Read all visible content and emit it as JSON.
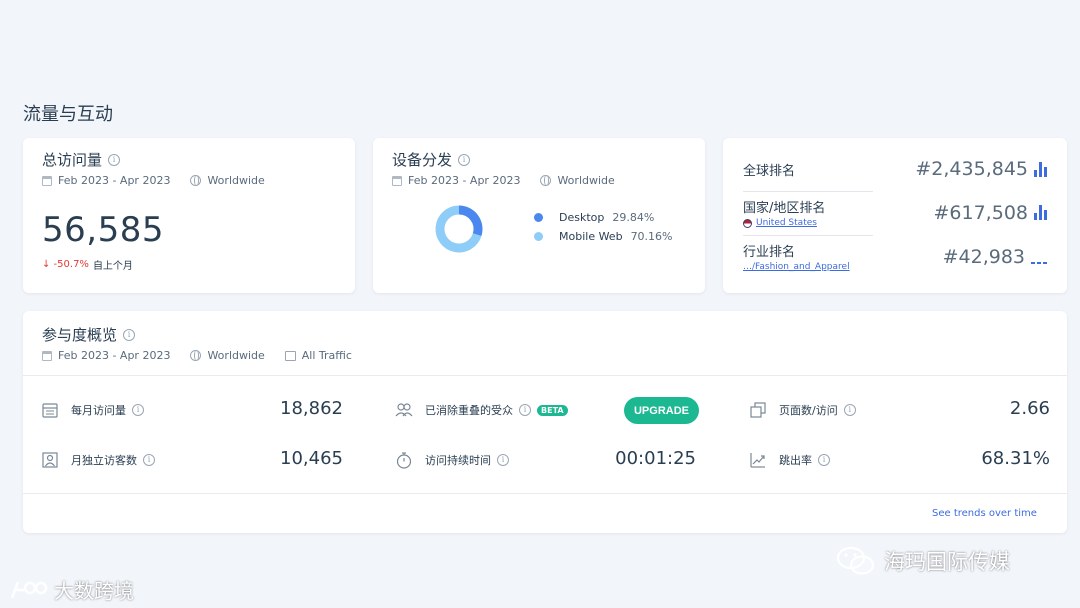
{
  "section_title": "流量与互动",
  "total_visits": {
    "title": "总访问量",
    "date_range": "Feb 2023 - Apr 2023",
    "region": "Worldwide",
    "value": "56,585",
    "change": "↓ -50.7%",
    "change_tail": "自上个月"
  },
  "device_split": {
    "title": "设备分发",
    "date_range": "Feb 2023 - Apr 2023",
    "region": "Worldwide",
    "items": [
      {
        "label": "Desktop",
        "value": "29.84%",
        "share": 0.2984,
        "color": "#4a87ee"
      },
      {
        "label": "Mobile Web",
        "value": "70.16%",
        "share": 0.7016,
        "color": "#8ecdf8"
      }
    ]
  },
  "rankings": {
    "global": {
      "label": "全球排名",
      "value": "#2,435,845"
    },
    "country": {
      "label": "国家/地区排名",
      "sub": "United States",
      "value": "#617,508"
    },
    "industry": {
      "label": "行业排名",
      "sub": "…/Fashion_and_Apparel",
      "value": "#42,983"
    }
  },
  "engagement": {
    "title": "参与度概览",
    "date_range": "Feb 2023 - Apr 2023",
    "region": "Worldwide",
    "traffic": "All Traffic",
    "metrics": {
      "monthly_visits": {
        "label": "每月访问量",
        "value": "18,862"
      },
      "monthly_unique": {
        "label": "月独立访客数",
        "value": "10,465"
      },
      "dedup_audience": {
        "label": "已消除重叠的受众",
        "badge": "BETA",
        "button": "UPGRADE"
      },
      "visit_duration": {
        "label": "访问持续时间",
        "value": "00:01:25"
      },
      "pages_per_visit": {
        "label": "页面数/访问",
        "value": "2.66"
      },
      "bounce_rate": {
        "label": "跳出率",
        "value": "68.31%"
      }
    },
    "trend_link": "See trends over time"
  },
  "watermarks": {
    "left": "大数跨境",
    "right": "海玛国际传媒"
  }
}
